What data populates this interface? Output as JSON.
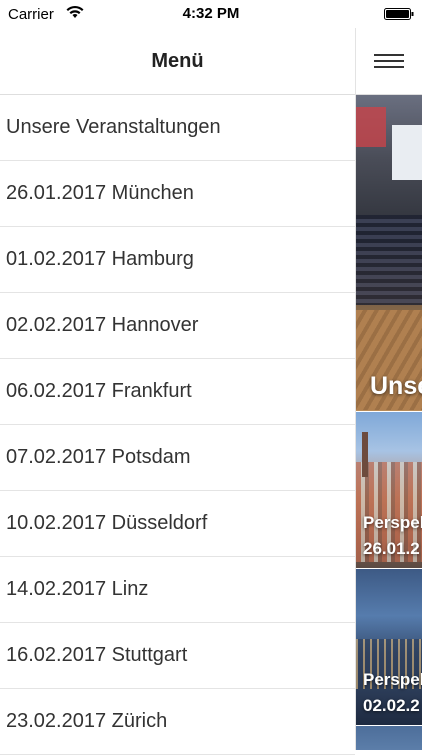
{
  "status_bar": {
    "carrier": "Carrier",
    "time": "4:32 PM"
  },
  "menu": {
    "title": "Menü",
    "items": [
      "Unsere Veranstaltungen",
      "26.01.2017 München",
      "01.02.2017 Hamburg",
      "02.02.2017 Hannover",
      "06.02.2017 Frankfurt",
      "07.02.2017 Potsdam",
      "10.02.2017 Düsseldorf",
      "14.02.2017 Linz",
      "16.02.2017 Stuttgart",
      "23.02.2017 Zürich"
    ]
  },
  "content": {
    "tiles": [
      {
        "title": "Unse"
      },
      {
        "line1": "Perspek",
        "line2": "26.01.2"
      },
      {
        "line1": "Perspek",
        "line2": "02.02.2"
      }
    ]
  },
  "icons": {
    "wifi": "wifi-icon",
    "battery": "battery-icon",
    "menu": "hamburger-icon"
  }
}
